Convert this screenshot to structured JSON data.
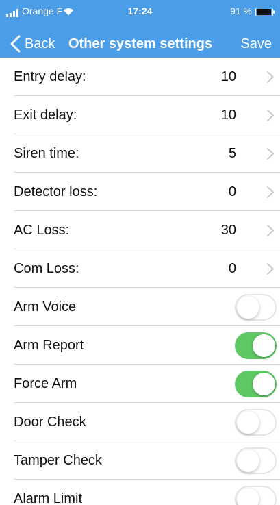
{
  "status_bar": {
    "carrier": "Orange F",
    "time": "17:24",
    "battery": "91 %"
  },
  "nav": {
    "back_label": "Back",
    "title": "Other system settings",
    "save_label": "Save"
  },
  "colors": {
    "header": "#4a9de6",
    "toggle_on": "#5fc764",
    "toggle_off_border": "#e5e5e5",
    "chevron": "#c7c7cc",
    "divider": "#d9d9d9"
  },
  "settings": {
    "value_rows": [
      {
        "label": "Entry delay:",
        "value": "10"
      },
      {
        "label": "Exit delay:",
        "value": "10"
      },
      {
        "label": "Siren time:",
        "value": "5"
      },
      {
        "label": "Detector loss:",
        "value": "0"
      },
      {
        "label": "AC Loss:",
        "value": "30"
      },
      {
        "label": "Com Loss:",
        "value": "0"
      }
    ],
    "toggle_rows": [
      {
        "label": "Arm Voice",
        "on": false
      },
      {
        "label": "Arm Report",
        "on": true
      },
      {
        "label": "Force Arm",
        "on": true
      },
      {
        "label": "Door Check",
        "on": false
      },
      {
        "label": "Tamper Check",
        "on": false
      },
      {
        "label": "Alarm Limit",
        "on": false
      }
    ]
  }
}
